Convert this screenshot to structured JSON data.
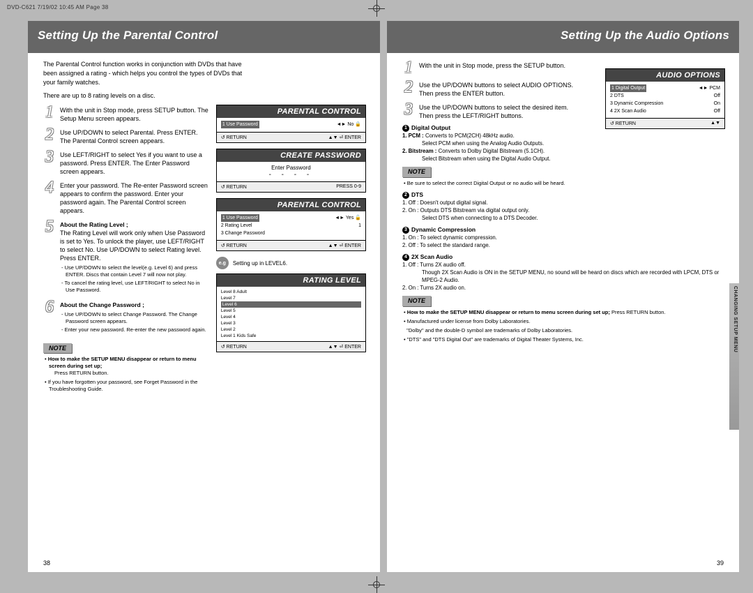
{
  "header": "DVD-C621  7/19/02  10:45 AM  Page 38",
  "left": {
    "title": "Setting Up the Parental Control",
    "intro1": "The Parental Control function works in conjunction with DVDs that have been assigned a rating - which helps you control the types of DVDs that your family watches.",
    "intro2": "There are up to 8 rating levels on a disc.",
    "steps": {
      "s1": "With the unit in Stop mode, press SETUP button. The Setup Menu screen appears.",
      "s2": "Use UP/DOWN to select Parental. Press ENTER. The Parental Control screen appears.",
      "s3": "Use LEFT/RIGHT to select Yes if you want to use a password. Press ENTER. The Enter Password screen appears.",
      "s4": "Enter your password. The Re-enter Password screen appears to confirm the password. Enter your password again. The Parental Control screen appears.",
      "s5_bold": "About the Rating Level ;",
      "s5_body": "The Rating Level will work only when Use Password is set to Yes. To unlock the player, use LEFT/RIGHT to select No. Use UP/DOWN to select Rating level. Press ENTER.",
      "s5_sub1": "- Use UP/DOWN to select the level(e.g. Level 6) and press ENTER. Discs that contain Level 7 will now not play.",
      "s5_sub2": "- To cancel the rating level, use LEFT/RIGHT to select No in Use Password.",
      "s6_bold": "About the Change Password ;",
      "s6_sub1": "- Use UP/DOWN to select Change Password. The Change Password screen appears.",
      "s6_sub2": "- Enter your new password. Re-enter the new password again."
    },
    "note_label": "NOTE",
    "notes": {
      "n1b": "How to make the SETUP MENU disappear or return to menu screen during set up;",
      "n1": "Press RETURN button.",
      "n2": "If you have forgotten your password, see Forget Password in the Troubleshooting Guide."
    },
    "osd1": {
      "title": "PARENTAL CONTROL",
      "row1l": "1   Use Password",
      "row1r": "◄► No 🔒",
      "foot_l": "↺ RETURN",
      "foot_r": "▲▼  ⏎ ENTER"
    },
    "osd2": {
      "title": "CREATE PASSWORD",
      "body1": "Enter Password",
      "dashes": "- - - -",
      "foot_l": "↺ RETURN",
      "foot_r": "PRESS 0-9"
    },
    "osd3": {
      "title": "PARENTAL CONTROL",
      "row1l": "1   Use Password",
      "row1r": "◄► Yes 🔓",
      "row2l": "2   Rating Level",
      "row2r": "1",
      "row3l": "3   Change Password",
      "foot_l": "↺ RETURN",
      "foot_r": "▲▼  ⏎ ENTER"
    },
    "eg_label": "e.g",
    "eg_text": "Setting up in LEVEL6.",
    "osd4": {
      "title": "RATING LEVEL",
      "rows": [
        "Level 8 Adult",
        "Level 7",
        "Level 6",
        "Level 5",
        "Level 4",
        "Level 3",
        "Level 2",
        "Level 1 Kids Safe"
      ],
      "sel": 2,
      "foot_l": "↺ RETURN",
      "foot_r": "▲▼  ⏎ ENTER"
    },
    "page_num": "38"
  },
  "right": {
    "title": "Setting Up the Audio Options",
    "steps": {
      "s1": "With the unit in Stop mode, press the SETUP button.",
      "s2": "Use the UP/DOWN buttons to select AUDIO OPTIONS. Then press the ENTER button.",
      "s3": "Use the UP/DOWN buttons to select the desired item. Then press the LEFT/RIGHT buttons."
    },
    "osd": {
      "title": "AUDIO OPTIONS",
      "rows": [
        {
          "l": "1  Digital Output",
          "r": "◄► PCM"
        },
        {
          "l": "2  DTS",
          "r": "Off"
        },
        {
          "l": "3  Dynamic Compression",
          "r": "On"
        },
        {
          "l": "4  2X Scan Audio",
          "r": "Off"
        }
      ],
      "foot_l": "↺ RETURN",
      "foot_r": "▲▼"
    },
    "detail": {
      "h1": "Digital Output",
      "d1a_b": "1. PCM :",
      "d1a": "Converts to PCM(2CH) 48kHz audio.",
      "d1a2": "Select PCM when using the Analog Audio Outputs.",
      "d1b_b": "2. Bitstream :",
      "d1b": "Converts to Dolby Digital Bitstream (5.1CH).",
      "d1b2": "Select Bitstream when using the Digital Audio Output.",
      "note1": "Be sure to select the correct Digital Output or  no audio will be heard.",
      "h2": "DTS",
      "d2a": "1. Off : Doesn't output digital signal.",
      "d2b": "2. On : Outputs DTS Bitstream via digital output only.",
      "d2b2": "Select DTS when connecting to a DTS Decoder.",
      "h3": "Dynamic Compression",
      "d3a": "1. On : To select dynamic compression.",
      "d3b": "2. Off : To select the standard range.",
      "h4": "2X Scan Audio",
      "d4a": "1. Off : Turns 2X audio off.",
      "d4a2": "Though 2X Scan Audio is ON in the SETUP MENU, no sound will be heard on discs which are recorded with LPCM, DTS or MPEG-2 Audio.",
      "d4b": "2. On : Turns 2X audio on."
    },
    "note_label": "NOTE",
    "notes": {
      "n1b": "How to make the SETUP MENU disappear or return to menu screen during set up;",
      "n1t": "Press RETURN button.",
      "n2": "Manufactured under license from Dolby Laboratories.",
      "n3": "\"Dolby\" and the double-D symbol are trademarks of Dolby Laboratories.",
      "n4": "\"DTS\" and \"DTS Digital Out\" are trademarks of Digital Theater Systems, Inc."
    },
    "side_tab": "CHANGING SETUP MENU",
    "page_num": "39"
  }
}
